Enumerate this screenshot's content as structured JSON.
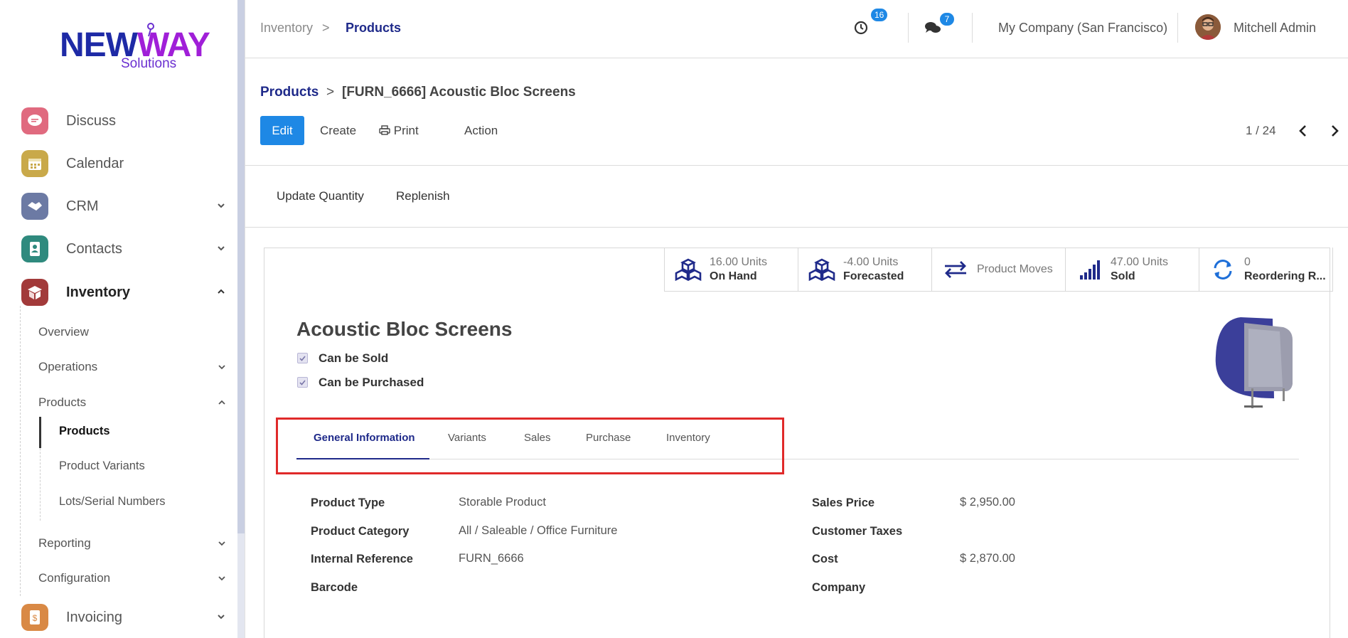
{
  "logo": {
    "brand_part1": "NEW",
    "brand_part2": "WAY",
    "subtitle": "Solutions"
  },
  "sidebar": {
    "apps": [
      {
        "label": "Discuss",
        "icon": "discuss-icon",
        "color": "#e06a7f"
      },
      {
        "label": "Calendar",
        "icon": "calendar-icon",
        "color": "#c9a94a"
      },
      {
        "label": "CRM",
        "icon": "crm-handshake-icon",
        "color": "#6c7aa4"
      },
      {
        "label": "Contacts",
        "icon": "contacts-icon",
        "color": "#2f8a7e"
      },
      {
        "label": "Inventory",
        "icon": "inventory-box-icon",
        "color": "#a23a3a"
      },
      {
        "label": "Invoicing",
        "icon": "invoicing-icon",
        "color": "#d98945"
      }
    ],
    "inventory_menu": {
      "overview": "Overview",
      "operations": "Operations",
      "products": "Products",
      "products_children": [
        "Products",
        "Product Variants",
        "Lots/Serial Numbers"
      ],
      "reporting": "Reporting",
      "configuration": "Configuration"
    }
  },
  "topbar": {
    "breadcrumb": [
      "Inventory",
      "Products"
    ],
    "breadcrumb_sep": ">",
    "activity_count": "16",
    "messages_count": "7",
    "company": "My Company (San Francisco)",
    "user": "Mitchell Admin"
  },
  "control_panel": {
    "breadcrumb": [
      "Products",
      "[FURN_6666] Acoustic Bloc Screens"
    ],
    "breadcrumb_sep": ">",
    "edit": "Edit",
    "create": "Create",
    "print": "Print",
    "action": "Action",
    "pager": "1 / 24"
  },
  "status_buttons": [
    "Update Quantity",
    "Replenish"
  ],
  "smart_buttons": [
    {
      "value": "16.00 Units",
      "label": "On Hand",
      "icon": "cubes-icon"
    },
    {
      "value": "-4.00 Units",
      "label": "Forecasted",
      "icon": "cubes-icon"
    },
    {
      "value": "",
      "label": "Product Moves",
      "icon": "exchange-arrows-icon"
    },
    {
      "value": "47.00 Units",
      "label": "Sold",
      "icon": "signal-bars-icon"
    },
    {
      "value": "0",
      "label": "Reordering R...",
      "icon": "refresh-icon"
    }
  ],
  "product": {
    "name": "Acoustic Bloc Screens",
    "can_be_sold": "Can be Sold",
    "can_be_purchased": "Can be Purchased"
  },
  "tabs": [
    "General Information",
    "Variants",
    "Sales",
    "Purchase",
    "Inventory"
  ],
  "fields_left": [
    {
      "label": "Product Type",
      "value": "Storable Product"
    },
    {
      "label": "Product Category",
      "value": "All / Saleable / Office Furniture"
    },
    {
      "label": "Internal Reference",
      "value": "FURN_6666"
    },
    {
      "label": "Barcode",
      "value": ""
    }
  ],
  "fields_right": [
    {
      "label": "Sales Price",
      "value": "$ 2,950.00"
    },
    {
      "label": "Customer Taxes",
      "value": ""
    },
    {
      "label": "Cost",
      "value": "$ 2,870.00"
    },
    {
      "label": "Company",
      "value": ""
    }
  ],
  "colors": {
    "accent": "#1e88e5",
    "brand_dark": "#1f2a8a",
    "highlight": "#e02a2a"
  }
}
